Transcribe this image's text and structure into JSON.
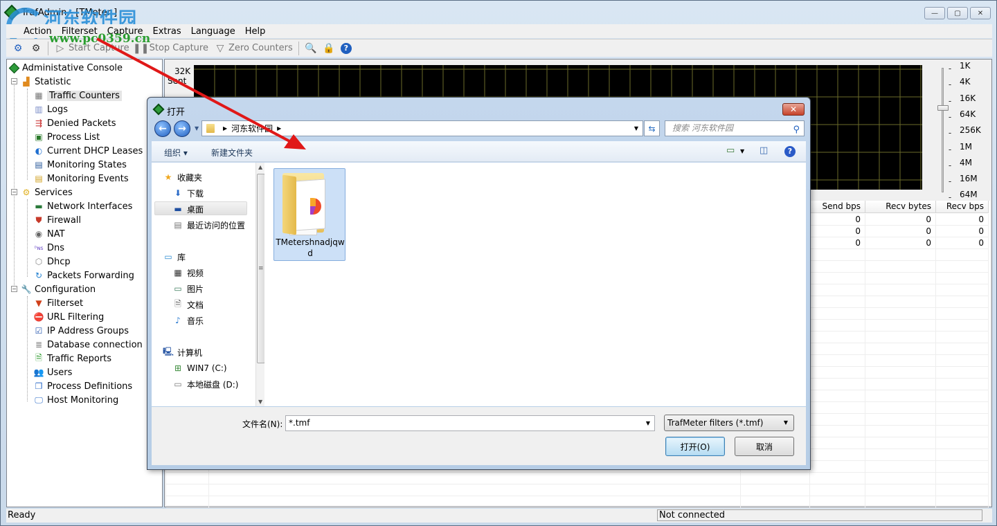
{
  "window": {
    "title": "TrafAdmin - [TMeter ]",
    "controls": {
      "minimize": "—",
      "maximize": "▢",
      "close": "✕"
    },
    "watermark": {
      "text": "河东软件园",
      "url_text": "www.pc0359.cn"
    }
  },
  "menu": [
    "Action",
    "Filterset",
    "Capture",
    "Extras",
    "Language",
    "Help"
  ],
  "toolbar": {
    "start_capture": "Start Capture",
    "stop_capture": "Stop Capture",
    "zero_counters": "Zero Counters"
  },
  "tree": {
    "root": "Administative Console",
    "groups": [
      {
        "label": "Statistic",
        "items": [
          "Traffic Counters",
          "Logs",
          "Denied Packets",
          "Process List",
          "Current DHCP Leases",
          "Monitoring States",
          "Monitoring Events"
        ]
      },
      {
        "label": "Services",
        "items": [
          "Network Interfaces",
          "Firewall",
          "NAT",
          "Dns",
          "Dhcp",
          "Packets Forwarding"
        ]
      },
      {
        "label": "Configuration",
        "items": [
          "Filterset",
          "URL Filtering",
          "IP Address Groups",
          "Database connection",
          "Traffic Reports",
          "Users",
          "Process Definitions",
          "Host Monitoring"
        ]
      }
    ],
    "selected": "Traffic Counters"
  },
  "graph": {
    "y_max_label": "32K",
    "series_label": "Sent",
    "scale_labels": [
      "1K",
      "4K",
      "16K",
      "64K",
      "256K",
      "1M",
      "4M",
      "16M",
      "64M"
    ],
    "scale_selected": "64K"
  },
  "table": {
    "columns": [
      "Send bps",
      "Recv bytes",
      "Recv bps"
    ],
    "rows": [
      [
        "0",
        "0",
        "0"
      ],
      [
        "0",
        "0",
        "0"
      ],
      [
        "0",
        "0",
        "0"
      ]
    ]
  },
  "status": {
    "left": "Ready",
    "connection": "Not connected"
  },
  "dialog": {
    "title": "打开",
    "breadcrumb": "河东软件园",
    "search_placeholder": "搜索 河东软件园",
    "organize": "组织 ▾",
    "new_folder": "新建文件夹",
    "nav": {
      "favorites": "收藏夹",
      "favorites_items": [
        "下载",
        "桌面",
        "最近访问的位置"
      ],
      "libraries": "库",
      "library_items": [
        "视频",
        "图片",
        "文档",
        "音乐"
      ],
      "computer": "计算机",
      "computer_items": [
        "WIN7 (C:)",
        "本地磁盘 (D:)"
      ],
      "selected": "桌面"
    },
    "files": [
      {
        "name": "TMetershnadjqwd",
        "type": "folder"
      }
    ],
    "filename_label": "文件名(N):",
    "filename_value": "*.tmf",
    "filetype_value": "TrafMeter filters (*.tmf)",
    "open_button": "打开(O)",
    "cancel_button": "取消"
  }
}
